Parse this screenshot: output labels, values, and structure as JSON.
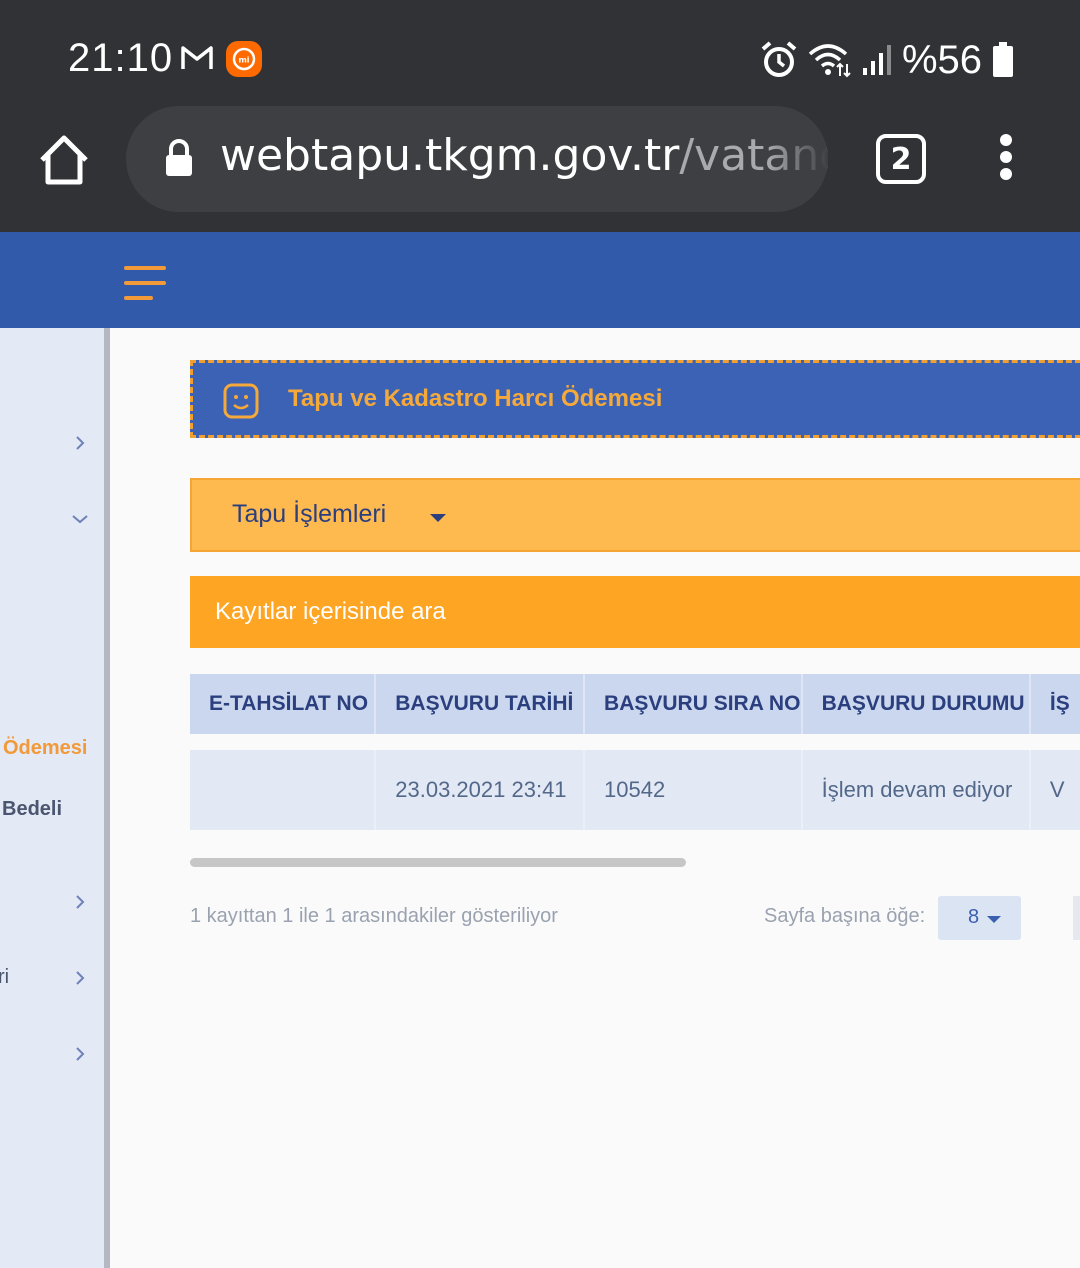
{
  "status_bar": {
    "time": "21:10",
    "battery_text": "%56",
    "icons": [
      "gmail-icon",
      "mi-app-icon",
      "alarm-icon",
      "wifi-icon",
      "signal-icon",
      "battery-icon"
    ]
  },
  "browser": {
    "url_host": "webtapu.tkgm.gov.tr",
    "url_path": "/vatanda",
    "tab_count": "2"
  },
  "sidebar": {
    "item_odemesi": "Ödemesi",
    "item_bedeli": "Bedeli",
    "item_ri": "ri"
  },
  "main": {
    "title": "Tapu ve Kadastro Harcı Ödemesi",
    "select_label": "Tapu İşlemleri",
    "search_placeholder": "Kayıtlar içerisinde ara"
  },
  "table": {
    "headers": [
      "E-TAHSİLAT NO",
      "BAŞVURU TARİHİ",
      "BAŞVURU SIRA NO",
      "BAŞVURU DURUMU",
      "İŞ"
    ],
    "rows": [
      [
        "",
        "23.03.2021 23:41",
        "10542",
        "İşlem devam ediyor",
        "V"
      ]
    ]
  },
  "footer": {
    "info": "1 kayıttan 1 ile 1 arasındakiler gösteriliyor",
    "per_page_label": "Sayfa başına öğe:",
    "per_page_value": "8"
  },
  "colors": {
    "header_blue": "#325aab",
    "title_blue": "#3b62b5",
    "orange": "#fea524",
    "light_orange": "#feb94f",
    "accent_orange": "#f29a3a"
  }
}
